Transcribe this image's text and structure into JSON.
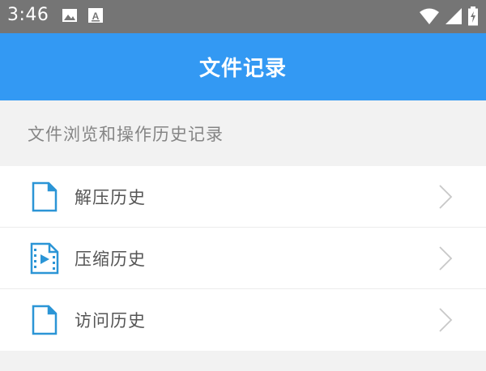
{
  "status_bar": {
    "time": "3:46",
    "left_icons": [
      "image-icon",
      "font-download-icon"
    ],
    "right_icons": [
      "wifi-icon",
      "signal-icon",
      "battery-icon"
    ]
  },
  "app_bar": {
    "title": "文件记录"
  },
  "section": {
    "header": "文件浏览和操作历史记录"
  },
  "list": {
    "items": [
      {
        "label": "解压历史",
        "icon": "document-icon"
      },
      {
        "label": "压缩历史",
        "icon": "video-file-icon"
      },
      {
        "label": "访问历史",
        "icon": "document-icon"
      }
    ]
  },
  "colors": {
    "accent": "#3399f3",
    "status_bar": "#757575",
    "icon": "#2b95d6"
  }
}
